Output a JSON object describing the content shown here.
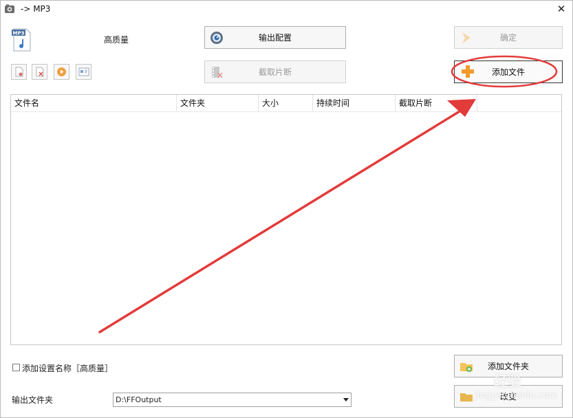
{
  "window": {
    "title": "-> MP3"
  },
  "preset": {
    "name": "高质量"
  },
  "buttons": {
    "output_config": "输出配置",
    "ok": "确定",
    "clip": "截取片断",
    "add_file": "添加文件",
    "add_folder": "添加文件夹",
    "change": "改变"
  },
  "file_list": {
    "columns": [
      "文件名",
      "文件夹",
      "大小",
      "持续时间",
      "截取片断"
    ]
  },
  "options": {
    "add_setting_name_label": "添加设置名称［高质量］",
    "add_setting_name_checked": false
  },
  "output": {
    "label": "输出文件夹",
    "folder": "D:\\FFOutput"
  },
  "watermark": {
    "line1": "经验",
    "line2": "jingyan.baidu.com"
  },
  "colors": {
    "annotation_red": "#e33a3a"
  }
}
